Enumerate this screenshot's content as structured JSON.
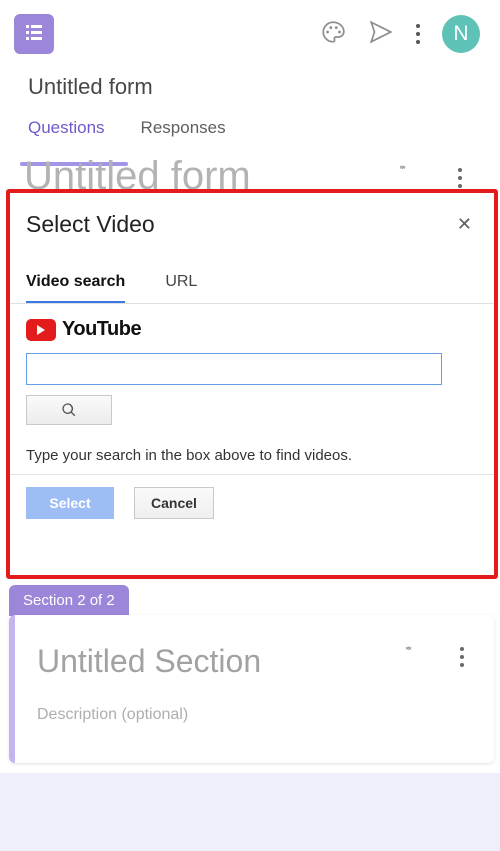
{
  "header": {
    "avatar_initial": "N"
  },
  "form": {
    "title": "Untitled form",
    "tabs": {
      "questions": "Questions",
      "responses": "Responses"
    },
    "card_title": "Untitled form"
  },
  "modal": {
    "title": "Select Video",
    "tabs": {
      "search": "Video search",
      "url": "URL"
    },
    "youtube_label": "YouTube",
    "search_value": "",
    "hint": "Type your search in the box above to find videos.",
    "select_label": "Select",
    "cancel_label": "Cancel"
  },
  "section": {
    "badge": "Section 2 of 2",
    "title": "Untitled Section",
    "description": "Description (optional)"
  }
}
